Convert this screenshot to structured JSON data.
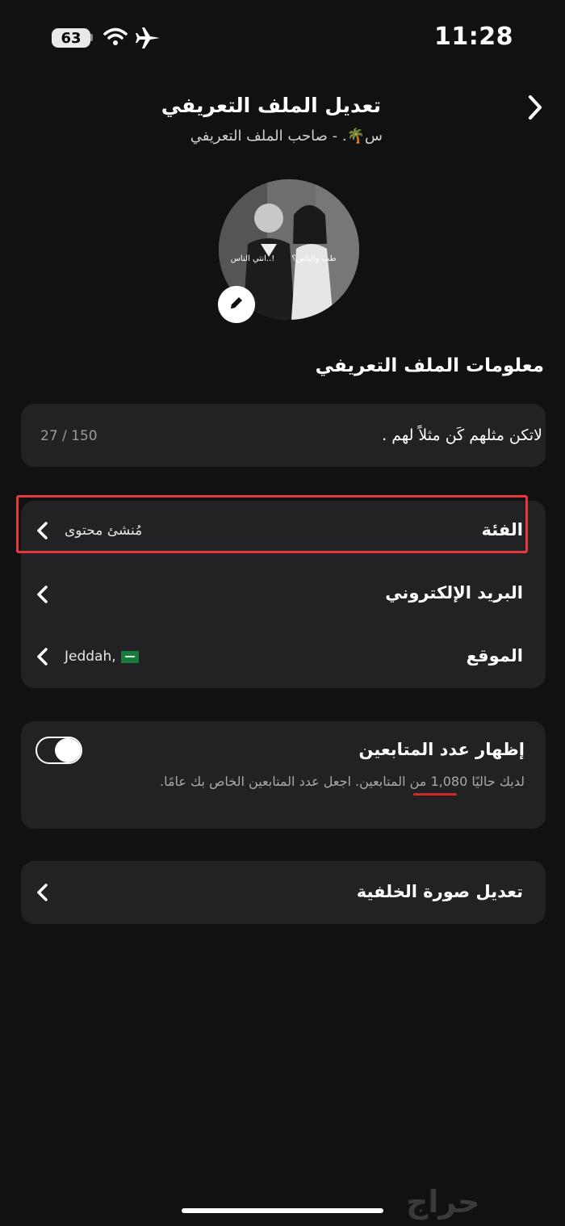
{
  "status_bar": {
    "time": "11:28",
    "battery_level": "63",
    "icons": [
      "wifi-icon",
      "airplane-icon"
    ]
  },
  "header": {
    "title": "تعديل الملف التعريفي",
    "subtitle": "س🌴. - صاحب الملف التعريفي",
    "back_icon": "chevron-right-icon"
  },
  "avatar": {
    "photo_text_right": "طب والناس؟",
    "photo_text_left": "انتي الناس..!",
    "edit_icon": "pencil-icon"
  },
  "profile_info": {
    "heading": "معلومات الملف التعريفي",
    "bio": {
      "text": "لاتكن مثلهم كَن مثلاً لهم .",
      "counter": "27 / 150"
    },
    "rows": [
      {
        "label": "الفئة",
        "value": "مُنشئ محتوى",
        "highlighted": true
      },
      {
        "label": "البريد الإلكتروني",
        "value": ""
      },
      {
        "label": "الموقع",
        "value": "Jeddah,"
      }
    ]
  },
  "followers_toggle": {
    "title": "إظهار عدد المتابعين",
    "description": "لديك حاليًا 1,080 من المتابعين. اجعل عدد المتابعين الخاص بك عامًا.",
    "enabled": true
  },
  "background_image": {
    "label": "تعديل صورة الخلفية"
  },
  "watermark": "حراج",
  "colors": {
    "background": "#111112",
    "card": "#222224",
    "highlight": "#e5383b",
    "secondary_text": "#a9a9a9"
  }
}
